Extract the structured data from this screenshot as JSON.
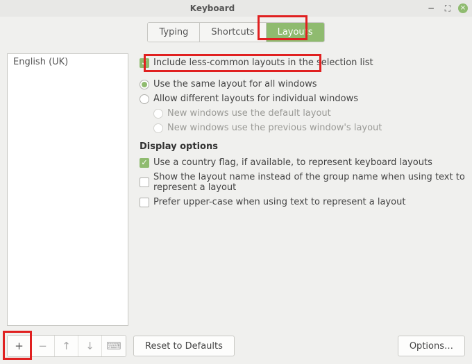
{
  "window": {
    "title": "Keyboard"
  },
  "tabs": {
    "typing": "Typing",
    "shortcuts": "Shortcuts",
    "layouts": "Layouts"
  },
  "sidebar": {
    "items": [
      {
        "label": "English (UK)"
      }
    ]
  },
  "options": {
    "include_less_common": "Include less-common layouts in the selection list",
    "same_layout_all": "Use the same layout for all windows",
    "allow_diff_layouts": "Allow different layouts for individual windows",
    "new_win_default": "New windows use the default layout",
    "new_win_previous": "New windows use the previous window's layout"
  },
  "display": {
    "header": "Display options",
    "country_flag": "Use a country flag, if available,  to represent keyboard layouts",
    "layout_name": "Show the layout name instead of the group name when using text to represent a layout",
    "prefer_upper": "Prefer upper-case when using text to represent a layout"
  },
  "buttons": {
    "reset": "Reset to Defaults",
    "options": "Options…"
  },
  "icons": {
    "minimize": "−",
    "maximize": "⛶",
    "close": "×",
    "add": "+",
    "remove": "−",
    "up": "↑",
    "down": "↓",
    "keyboard": "⌨",
    "check": "✓"
  }
}
